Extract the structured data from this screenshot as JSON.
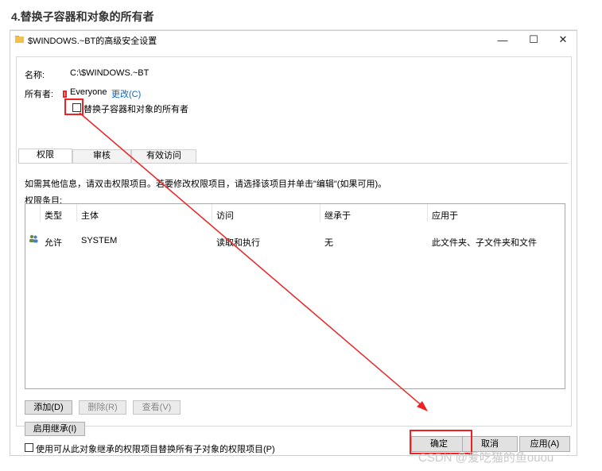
{
  "heading": "4.替换子容器和对象的所有者",
  "window": {
    "title": "$WINDOWS.~BT的高级安全设置",
    "minimize_glyph": "—",
    "maximize_glyph": "☐",
    "close_glyph": "✕"
  },
  "info": {
    "name_label": "名称:",
    "name_value": "C:\\$WINDOWS.~BT",
    "owner_label": "所有者:",
    "owner_value": "Everyone",
    "change_link": "更改(C)",
    "replace_checkbox_label": "替换子容器和对象的所有者"
  },
  "tabs": [
    {
      "label": "权限"
    },
    {
      "label": "审核"
    },
    {
      "label": "有效访问"
    }
  ],
  "instructions": "如需其他信息，请双击权限项目。若要修改权限项目，请选择该项目并单击\"编辑\"(如果可用)。",
  "entries_label": "权限条目:",
  "columns": [
    "类型",
    "主体",
    "访问",
    "继承于",
    "应用于"
  ],
  "rows": [
    {
      "type": "允许",
      "principal": "SYSTEM",
      "access": "读取和执行",
      "inherited": "无",
      "applies_to": "此文件夹、子文件夹和文件"
    }
  ],
  "buttons": {
    "add": "添加(D)",
    "remove": "删除(R)",
    "view": "查看(V)",
    "enable_inheritance": "启用继承(I)"
  },
  "replace_all_label": "使用可从此对象继承的权限项目替换所有子对象的权限项目(P)",
  "footer": {
    "ok": "确定",
    "cancel": "取消",
    "apply": "应用(A)"
  },
  "watermark": "CSDN @爱吃猫的鱼ouou",
  "colors": {
    "annotation": "#ee2222",
    "link": "#0066cc"
  }
}
